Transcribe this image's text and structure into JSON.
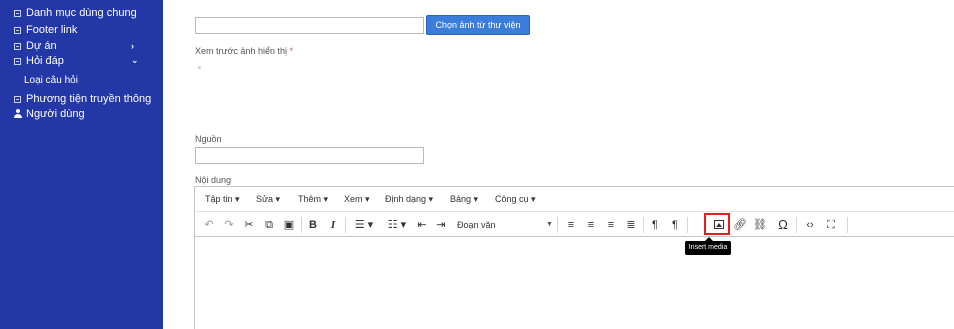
{
  "sidebar": {
    "items": [
      {
        "label": "Danh mục dùng chung"
      },
      {
        "label": "Footer link"
      },
      {
        "label": "Dự án"
      },
      {
        "label": "Hỏi đáp"
      }
    ],
    "submenu_item": "Loại câu hỏi",
    "media_label": "Phương tiện truyền thông",
    "users_label": "Người dùng",
    "colors": {
      "background": "#2437a6",
      "text": "#ffffff"
    }
  },
  "form": {
    "image_path_value": "",
    "library_button": "Chọn ảnh từ thư viện",
    "preview_label": "Xem trước ảnh hiển thị",
    "required_mark": "*",
    "source_label": "Nguồn",
    "source_value": "",
    "content_label": "Nội dung"
  },
  "editor": {
    "menus": [
      "Tập tin ▾",
      "Sửa ▾",
      "Thêm ▾",
      "Xem ▾",
      "Định dạng ▾",
      "Bảng ▾",
      "Công cụ ▾"
    ],
    "format_select": "Đoạn văn",
    "tooltip": "Insert media",
    "icons": [
      "undo-icon",
      "redo-icon",
      "cut-icon",
      "copy-icon",
      "paste-icon",
      "bold-icon",
      "italic-icon",
      "bullet-list-icon",
      "numbered-list-icon",
      "outdent-icon",
      "indent-icon",
      "align-left-icon",
      "align-center-icon",
      "align-right-icon",
      "justify-icon",
      "ltr-icon",
      "rtl-icon",
      "image-icon",
      "link-icon",
      "unlink-icon",
      "omega-icon",
      "code-icon",
      "fullscreen-icon"
    ],
    "highlight_color": "#e31c1c"
  }
}
